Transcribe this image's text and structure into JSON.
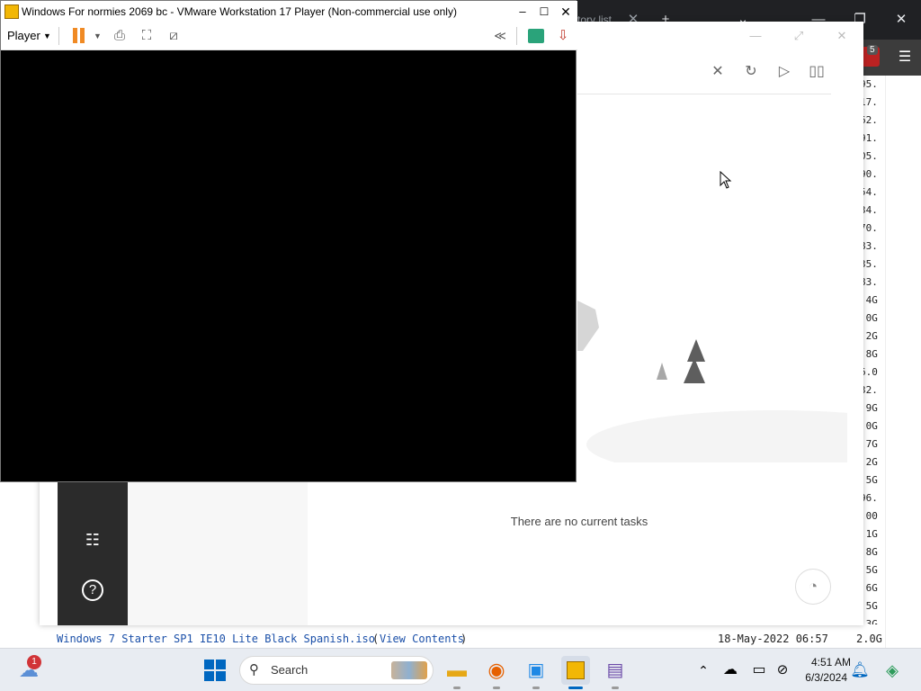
{
  "browser": {
    "tab_partial_label": "tory list",
    "badge_count": "5"
  },
  "directory": {
    "sizes": [
      "95.",
      "17.",
      "62.",
      "91.",
      "05.",
      "90.",
      "54.",
      "34.",
      "70.",
      "83.",
      "35.",
      "83.",
      ".4G",
      ".0G",
      ".2G",
      ".8G",
      "6.0",
      "32.",
      ".9G",
      ".0G",
      ".7G",
      ".2G",
      ".5G",
      "96.",
      ",00",
      ".1G",
      ".8G",
      ".5G",
      ".6G",
      ".5G",
      ".3G"
    ],
    "bottom_row": {
      "filename": "Windows 7 Starter SP1 IE10 Lite Black Spanish.iso",
      "view_contents": "View Contents",
      "date": "18-May-2022 06:57",
      "size": "2.0G"
    }
  },
  "download_manager": {
    "empty_message": "There are no current tasks",
    "icons": {
      "clear": "close-icon",
      "refresh": "refresh-icon",
      "play": "play-icon",
      "pause": "pause-icon",
      "settings": "sliders-icon",
      "help": "help-icon",
      "speed": "speedometer-icon"
    }
  },
  "vmware": {
    "title": "Windows For normies 2069 bc - VMware Workstation 17 Player (Non-commercial use only)",
    "player_menu": "Player"
  },
  "taskbar": {
    "search_placeholder": "Search",
    "weather_badge": "1",
    "time": "4:51 AM",
    "date": "6/3/2024"
  },
  "colors": {
    "vm_pause": "#f08a24",
    "accent_blue": "#0067c0",
    "dm_sidebar": "#2b2b2b"
  }
}
